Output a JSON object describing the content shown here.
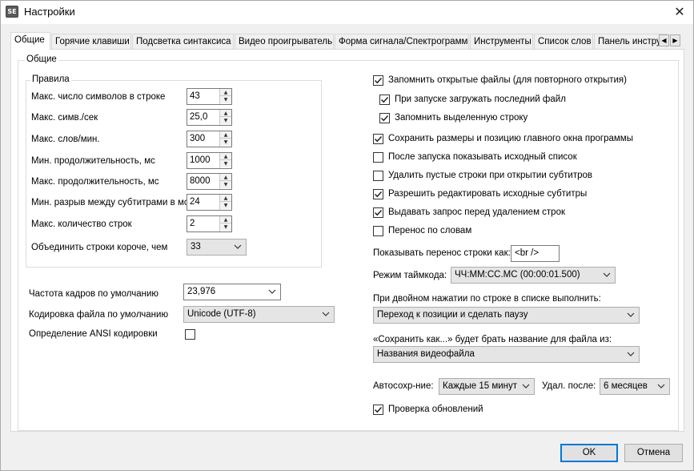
{
  "window": {
    "app_icon_text": "SE",
    "title": "Настройки",
    "close_glyph": "✕"
  },
  "tabs": [
    {
      "label": "Общие",
      "active": true
    },
    {
      "label": "Горячие клавиши"
    },
    {
      "label": "Подсветка синтаксиса"
    },
    {
      "label": "Видео проигрыватель"
    },
    {
      "label": "Форма сигнала/Спектрограмма"
    },
    {
      "label": "Инструменты"
    },
    {
      "label": "Список слов"
    },
    {
      "label": "Панель инстру"
    }
  ],
  "tab_scroll": {
    "left": "◀",
    "right": "▶"
  },
  "general": {
    "group_title": "Общие",
    "rules": {
      "group_title": "Правила",
      "items": [
        {
          "label": "Макс. число символов в строке",
          "value": "43"
        },
        {
          "label": "Макс. симв./сек",
          "value": "25,0"
        },
        {
          "label": "Макс. слов/мин.",
          "value": "300"
        },
        {
          "label": "Мин. продолжительность, мс",
          "value": "1000"
        },
        {
          "label": "Макс. продолжительность, мс",
          "value": "8000"
        },
        {
          "label": "Мин. разрыв между субтитрами в мс",
          "value": "24"
        },
        {
          "label": "Макс. количество строк",
          "value": "2"
        }
      ],
      "merge_label": "Объединить строки короче, чем",
      "merge_value": "33"
    },
    "frame_rate": {
      "label": "Частота кадров по умолчанию",
      "value": "23,976"
    },
    "encoding": {
      "label": "Кодировка файла по умолчанию",
      "value": "Unicode (UTF-8)"
    },
    "ansi_detect": {
      "label": "Определение ANSI кодировки",
      "checked": false
    },
    "checkboxes": [
      {
        "label": "Запомнить открытые файлы (для повторного открытия)",
        "checked": true
      },
      {
        "label": "При запуске загружать последний файл",
        "checked": true
      },
      {
        "label": "Запомнить выделенную строку",
        "checked": true
      },
      {
        "label": "Сохранить размеры и позицию главного окна программы",
        "checked": true
      },
      {
        "label": "После запуска показывать исходный список",
        "checked": false
      },
      {
        "label": "Удалить пустые строки при открытии субтитров",
        "checked": false
      },
      {
        "label": "Разрешить редактировать исходные субтитры",
        "checked": true
      },
      {
        "label": "Выдавать запрос перед удалением строк",
        "checked": true
      },
      {
        "label": "Перенос по словам",
        "checked": false
      }
    ],
    "line_break": {
      "label": "Показывать перенос строки как:",
      "value": "<br />"
    },
    "timecode_mode": {
      "label": "Режим таймкода:",
      "value": "ЧЧ:ММ:СС.МС (00:00:01.500)"
    },
    "double_click": {
      "label": "При двойном нажатии по строке в списке выполнить:",
      "value": "Переход к позиции и сделать паузу"
    },
    "save_as": {
      "label": "«Сохранить как...» будет брать название для файла из:",
      "value": "Названия видеофайла"
    },
    "autosave": {
      "label": "Автосохр-ние:",
      "value": "Каждые 15 минут"
    },
    "delete_after": {
      "label": "Удал. после:",
      "value": "6 месяцев"
    },
    "check_updates": {
      "label": "Проверка обновлений",
      "checked": true
    }
  },
  "buttons": {
    "ok": "OK",
    "cancel": "Отмена"
  }
}
